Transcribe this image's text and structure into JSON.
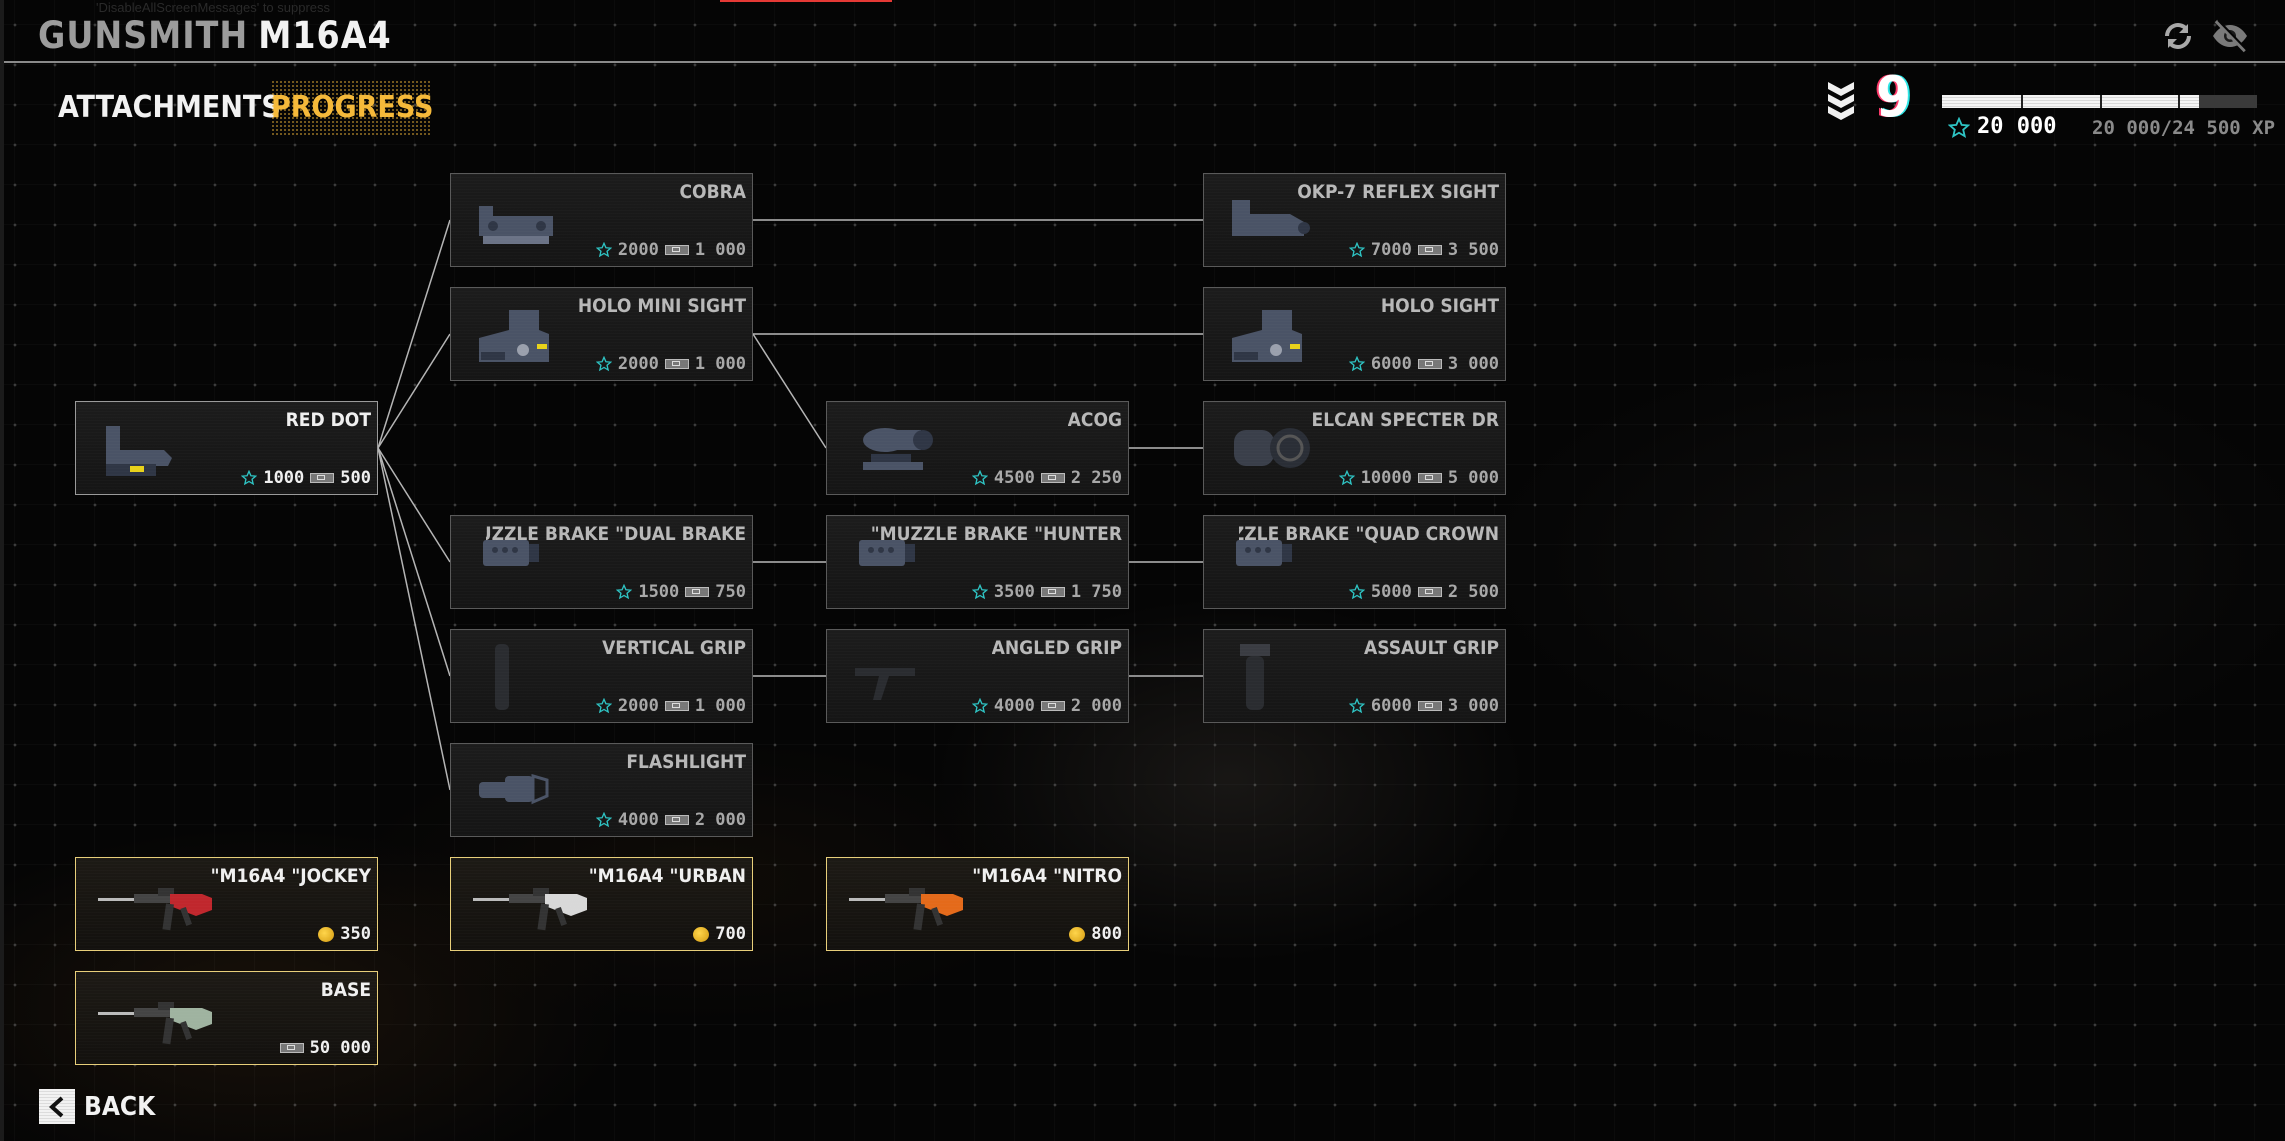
{
  "system_message": "'DisableAllScreenMessages' to suppress",
  "header": {
    "title_prefix": "GUNSMITH",
    "weapon": "M16A4"
  },
  "tabs": [
    {
      "label": "ATTACHMENTS",
      "active": false
    },
    {
      "label": "PROGRESS",
      "active": true
    }
  ],
  "toolbar": {
    "refresh_icon": "refresh-icon",
    "hide_icon": "eye-off-icon"
  },
  "progress": {
    "level": "9",
    "xp_current_label": "20 000",
    "xp_total_label": "20 000/24 500 XP",
    "xp_current": 20000,
    "xp_max": 24500,
    "segments": 4
  },
  "colors": {
    "accent_yellow": "#f5b93a",
    "star_teal": "#2ec4c4",
    "skin_border": "#e8cf7a",
    "alert_red": "#e53935"
  },
  "cards": [
    {
      "id": "red-dot",
      "name": "RED DOT",
      "xp": "1000",
      "cash": "500",
      "unlocked": true,
      "icon": "red-dot-sight-icon"
    },
    {
      "id": "cobra",
      "name": "COBRA",
      "xp": "2000",
      "cash": "1 000",
      "icon": "cobra-sight-icon"
    },
    {
      "id": "holo-mini",
      "name": "HOLO MINI SIGHT",
      "xp": "2000",
      "cash": "1 000",
      "icon": "holo-sight-icon"
    },
    {
      "id": "okp7",
      "name": "OKP-7 REFLEX SIGHT",
      "xp": "7000",
      "cash": "3 500",
      "icon": "reflex-sight-icon"
    },
    {
      "id": "holo",
      "name": "HOLO SIGHT",
      "xp": "6000",
      "cash": "3 000",
      "icon": "holo-sight-icon"
    },
    {
      "id": "acog",
      "name": "ACOG",
      "xp": "4500",
      "cash": "2 250",
      "icon": "acog-scope-icon"
    },
    {
      "id": "elcan",
      "name": "ELCAN SPECTER DR",
      "xp": "10000",
      "cash": "5 000",
      "icon": "elcan-scope-icon"
    },
    {
      "id": "dual-brake",
      "name": "MUZZLE BRAKE \"DUAL BRAKE\"",
      "xp": "1500",
      "cash": "750",
      "icon": "muzzle-brake-icon"
    },
    {
      "id": "hunter",
      "name": "MUZZLE BRAKE \"HUNTER\"",
      "xp": "3500",
      "cash": "1 750",
      "icon": "muzzle-brake-icon"
    },
    {
      "id": "quad-crown",
      "name": "MUZZLE BRAKE \"QUAD CROWN\"",
      "xp": "5000",
      "cash": "2 500",
      "icon": "muzzle-brake-icon"
    },
    {
      "id": "vertical-grip",
      "name": "VERTICAL GRIP",
      "xp": "2000",
      "cash": "1 000",
      "icon": "vertical-grip-icon"
    },
    {
      "id": "angled-grip",
      "name": "ANGLED GRIP",
      "xp": "4000",
      "cash": "2 000",
      "icon": "angled-grip-icon"
    },
    {
      "id": "assault-grip",
      "name": "ASSAULT GRIP",
      "xp": "6000",
      "cash": "3 000",
      "icon": "assault-grip-icon"
    },
    {
      "id": "flashlight",
      "name": "FLASHLIGHT",
      "xp": "4000",
      "cash": "2 000",
      "icon": "flashlight-icon"
    }
  ],
  "skins": [
    {
      "id": "jockey",
      "name": "M16A4 \"JOCKEY\"",
      "coins": "350",
      "color": "#c0272d"
    },
    {
      "id": "urban",
      "name": "M16A4 \"URBAN\"",
      "coins": "700",
      "color": "#d8d8d8"
    },
    {
      "id": "nitro",
      "name": "M16A4 \"NITRO\"",
      "coins": "800",
      "color": "#e46a1a"
    },
    {
      "id": "base",
      "name": "BASE",
      "cash": "50 000",
      "color": "#9fb3a0"
    }
  ],
  "footer": {
    "back_label": "BACK"
  }
}
